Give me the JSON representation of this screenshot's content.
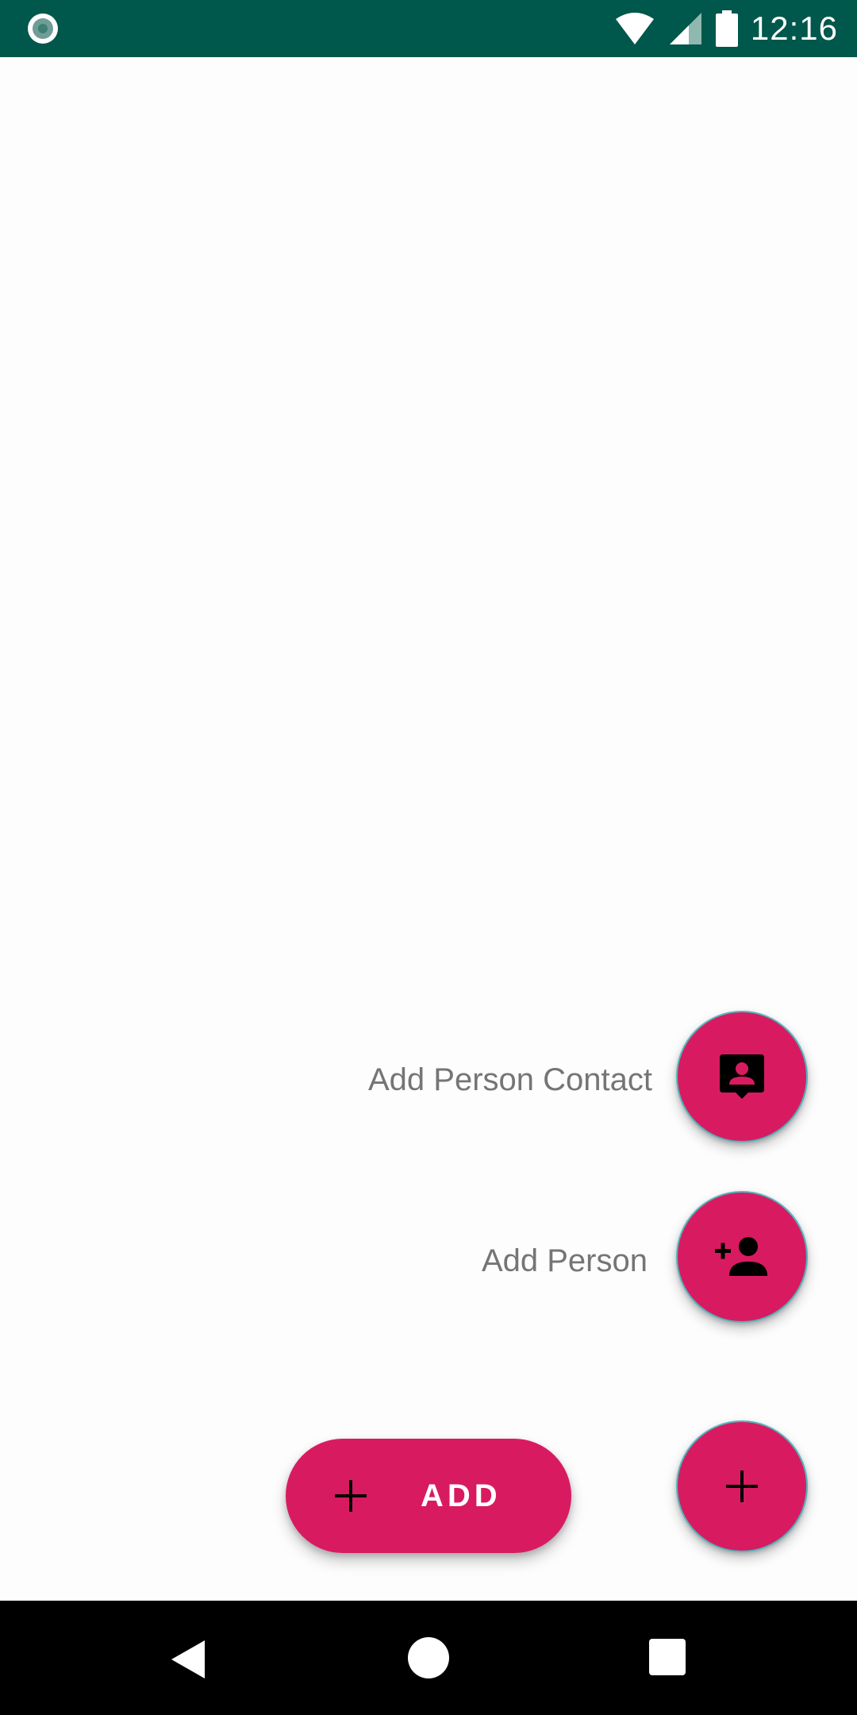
{
  "status_bar": {
    "time": "12:16",
    "background_color": "#00574b",
    "icons": [
      "notification-circle-icon",
      "wifi-icon",
      "cellular-signal-icon",
      "battery-icon"
    ]
  },
  "speed_dial": {
    "items": [
      {
        "label": "Add Person Contact",
        "icon": "contact-card-icon"
      },
      {
        "label": "Add Person",
        "icon": "person-add-icon"
      }
    ],
    "main_fab_icon": "plus-icon",
    "accent_color": "#d81b60"
  },
  "extended_fab": {
    "label": "ADD",
    "icon": "plus-icon"
  },
  "nav_bar": {
    "icons": [
      "back-icon",
      "home-icon",
      "recents-icon"
    ]
  }
}
